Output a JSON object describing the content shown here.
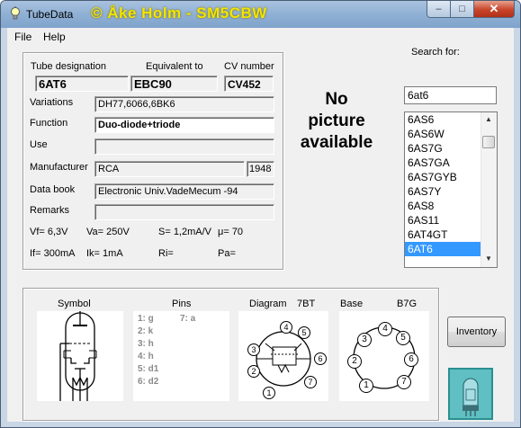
{
  "window": {
    "title": "TubeData",
    "credit": "© Åke Holm - SM5CBW",
    "controls": {
      "minimize": "–",
      "maximize": "□",
      "close": "✕"
    }
  },
  "menu": [
    "File",
    "Help"
  ],
  "tube": {
    "designation_label": "Tube designation",
    "designation": "6AT6",
    "equivalent_label": "Equivalent to",
    "equivalent": "EBC90",
    "cv_label": "CV number",
    "cv": "CV452",
    "variations_label": "Variations",
    "variations": "DH77,6066,6BK6",
    "function_label": "Function",
    "function": "Duo-diode+triode",
    "use_label": "Use",
    "use": "",
    "manufacturer_label": "Manufacturer",
    "manufacturer": "RCA",
    "year": "1948",
    "databook_label": "Data book",
    "databook": "Electronic Univ.VadeMecum -94",
    "remarks_label": "Remarks",
    "remarks": "",
    "vf": "Vf= 6,3V",
    "va": "Va=  250V",
    "s": "S= 1,2mA/V",
    "mu": "μ=     70",
    "if": "If= 300mA",
    "ik": "Ik=   1mA",
    "ri": "Ri=",
    "pa": "Pa="
  },
  "picture_placeholder": [
    "No",
    "picture",
    "available"
  ],
  "search": {
    "label": "Search for:",
    "value": "6at6",
    "results": [
      "6AS6",
      "6AS6W",
      "6AS7G",
      "6AS7GA",
      "6AS7GYB",
      "6AS7Y",
      "6AS8",
      "6AS11",
      "6AT4GT",
      "6AT6"
    ],
    "selected": "6AT6"
  },
  "bottom": {
    "symbol_label": "Symbol",
    "pins_label": "Pins",
    "diagram_label": "Diagram",
    "diagram_code": "7BT",
    "base_label": "Base",
    "base_code": "B7G",
    "pins": [
      "1: g",
      "2: k",
      "3: h",
      "4: h",
      "5: d1",
      "6: d2",
      "7: a"
    ],
    "diagram_pins": [
      "1",
      "2",
      "3",
      "4",
      "5",
      "6",
      "7"
    ],
    "base_pins": [
      "1",
      "2",
      "3",
      "4",
      "5",
      "6",
      "7"
    ]
  },
  "inventory_button": "Inventory",
  "colors": {
    "selection": "#3399ff",
    "credit": "#f4e400",
    "pin_text": "#8a8a8a"
  }
}
